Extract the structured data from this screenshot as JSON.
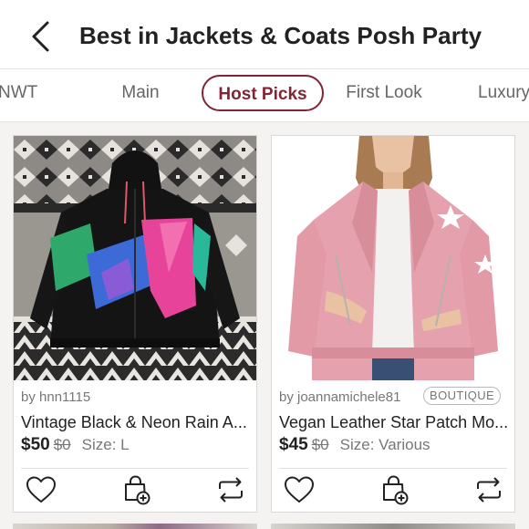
{
  "header": {
    "title": "Best in Jackets & Coats Posh Party",
    "back_icon": "chevron-left-icon"
  },
  "tabs": [
    {
      "label": "NWT",
      "active": false
    },
    {
      "label": "Main",
      "active": false
    },
    {
      "label": "Host Picks",
      "active": true
    },
    {
      "label": "First Look",
      "active": false
    },
    {
      "label": "Luxury",
      "active": false
    }
  ],
  "colors": {
    "accent": "#822432",
    "background": "#f4f3f2"
  },
  "listings": [
    {
      "seller": "by hnn1115",
      "badge": "",
      "title": "Vintage Black & Neon Rain A...",
      "price": "$50",
      "original_price": "$0",
      "size": "Size: L",
      "image": "black-neon-windbreaker-photo"
    },
    {
      "seller": "by joannamichele81",
      "badge": "BOUTIQUE",
      "title": "Vegan Leather Star Patch Mo...",
      "price": "$45",
      "original_price": "$0",
      "size": "Size: Various",
      "image": "pink-leather-moto-jacket-photo"
    }
  ],
  "actions": {
    "like_icon": "heart-icon",
    "bundle_icon": "shopping-bag-add-icon",
    "share_icon": "share-repeat-icon"
  }
}
